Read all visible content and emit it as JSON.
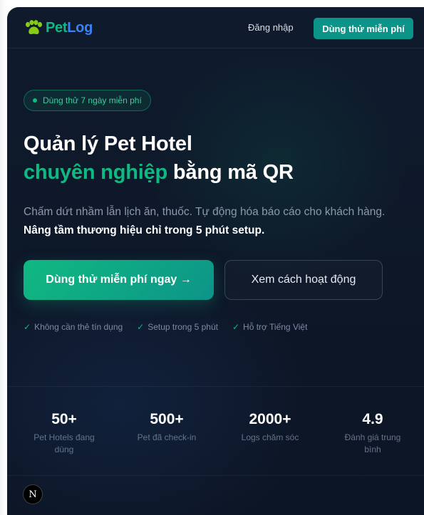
{
  "header": {
    "logo_pet": "Pet",
    "logo_log": "Log",
    "login_label": "Đăng nhập",
    "trial_label": "Dùng thử miễn phí"
  },
  "hero": {
    "badge": "Dùng thử 7 ngày miễn phí",
    "title_line1": "Quản lý Pet Hotel",
    "title_accent": "chuyên nghiệp",
    "title_line2_rest": " bằng mã QR",
    "desc_plain": "Chấm dứt nhầm lẫn lịch ăn, thuốc. Tự động hóa báo cáo cho khách hàng. ",
    "desc_bold": "Nâng tầm thương hiệu chỉ trong 5 phút setup.",
    "cta_primary": "Dùng thử miễn phí ngay →",
    "cta_secondary": "Xem cách hoạt động",
    "features": [
      "Không cần thẻ tín dụng",
      "Setup trong 5 phút",
      "Hỗ trợ Tiếng Việt"
    ]
  },
  "stats": [
    {
      "value": "50+",
      "label": "Pet Hotels đang dùng"
    },
    {
      "value": "500+",
      "label": "Pet đã check-in"
    },
    {
      "value": "2000+",
      "label": "Logs chăm sóc"
    },
    {
      "value": "4.9",
      "label": "Đánh giá trung bình"
    }
  ],
  "dev_badge": "N",
  "colors": {
    "brand_green": "#10b981",
    "brand_blue": "#3b82f6",
    "teal_button": "#0d9488",
    "background": "#0f1b2d"
  },
  "icons": {
    "logo": "paw-icon",
    "feature_check": "check-icon"
  }
}
